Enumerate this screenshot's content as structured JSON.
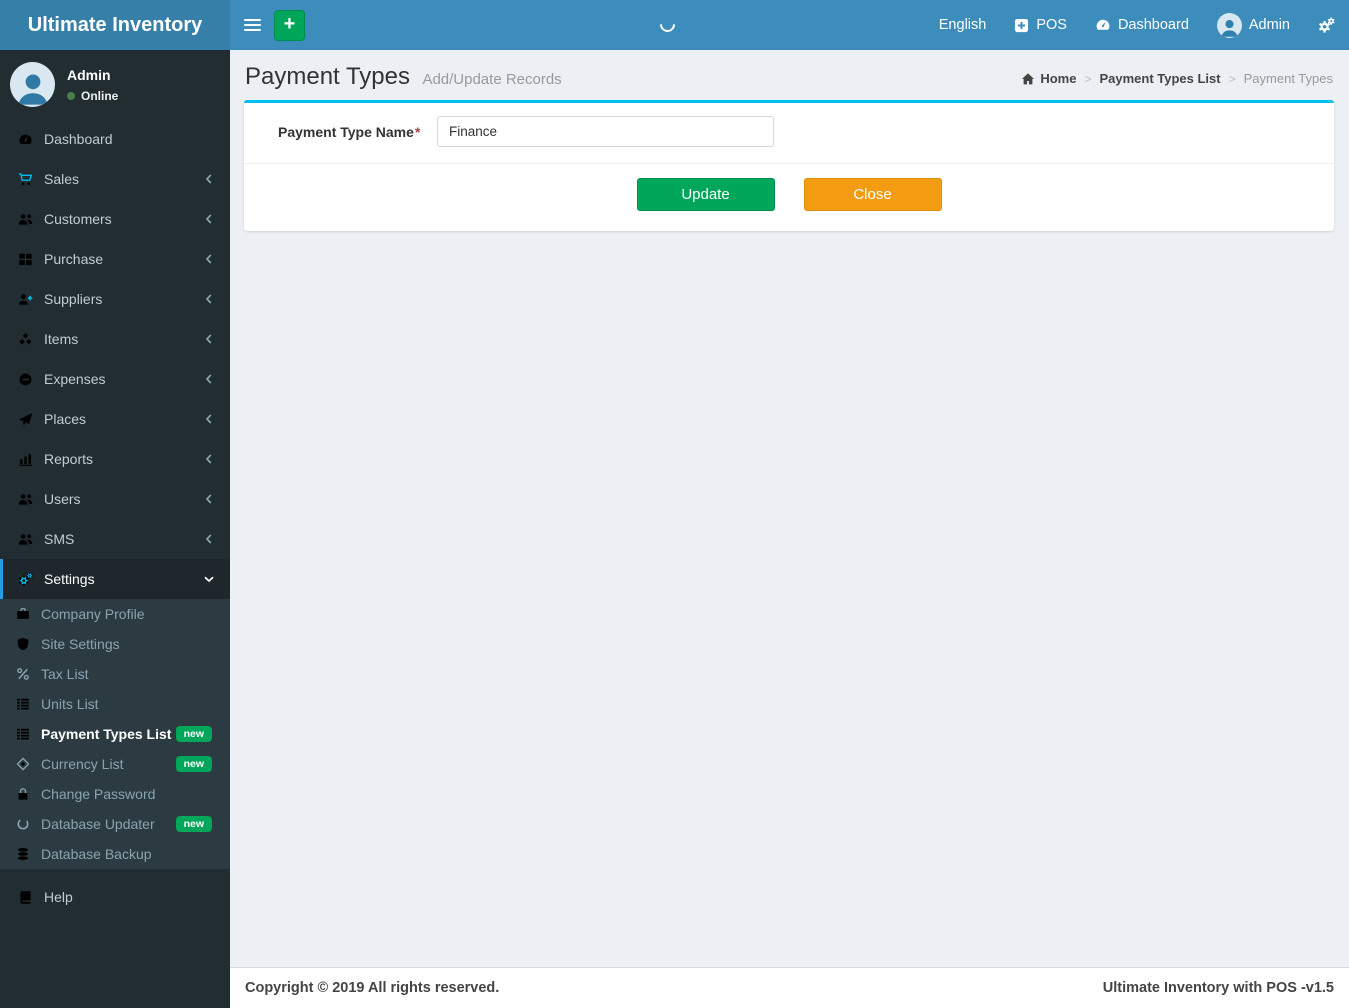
{
  "navbar": {
    "brand": "Ultimate Inventory",
    "language": "English",
    "pos": "POS",
    "dashboard": "Dashboard",
    "user": "Admin"
  },
  "sidebar": {
    "user": {
      "name": "Admin",
      "status": "Online"
    },
    "items": [
      {
        "label": "Dashboard"
      },
      {
        "label": "Sales"
      },
      {
        "label": "Customers"
      },
      {
        "label": "Purchase"
      },
      {
        "label": "Suppliers"
      },
      {
        "label": "Items"
      },
      {
        "label": "Expenses"
      },
      {
        "label": "Places"
      },
      {
        "label": "Reports"
      },
      {
        "label": "Users"
      },
      {
        "label": "SMS"
      },
      {
        "label": "Settings"
      }
    ],
    "settings_submenu": [
      {
        "label": "Company Profile"
      },
      {
        "label": "Site Settings"
      },
      {
        "label": "Tax List"
      },
      {
        "label": "Units List"
      },
      {
        "label": "Payment Types List",
        "badge": "new"
      },
      {
        "label": "Currency List",
        "badge": "new"
      },
      {
        "label": "Change Password"
      },
      {
        "label": "Database Updater",
        "badge": "new"
      },
      {
        "label": "Database Backup"
      }
    ],
    "help": {
      "label": "Help"
    }
  },
  "page": {
    "title": "Payment Types",
    "subtitle": "Add/Update Records",
    "breadcrumb": {
      "home": "Home",
      "parent": "Payment Types List",
      "current": "Payment Types",
      "sep": ">"
    }
  },
  "form": {
    "label": "Payment Type Name",
    "required_mark": "*",
    "value": "Finance",
    "update_label": "Update",
    "close_label": "Close"
  },
  "footer": {
    "copyright": "Copyright © 2019 All rights reserved.",
    "brand": "Ultimate Inventory with POS -v1.5"
  },
  "colors": {
    "navbar": "#3c8dbc",
    "logo_bg": "#367fa9",
    "sidebar_bg": "#222d32",
    "submenu_bg": "#2c3b41",
    "sidebar_icon": "#00c0ef",
    "active_border": "#259de0",
    "success": "#00a65a",
    "warning": "#f39c12",
    "box_top_border": "#00c0ef",
    "content_bg": "#ecf0f5",
    "badge": "#00a65a",
    "online_dot": "#4b8049"
  }
}
